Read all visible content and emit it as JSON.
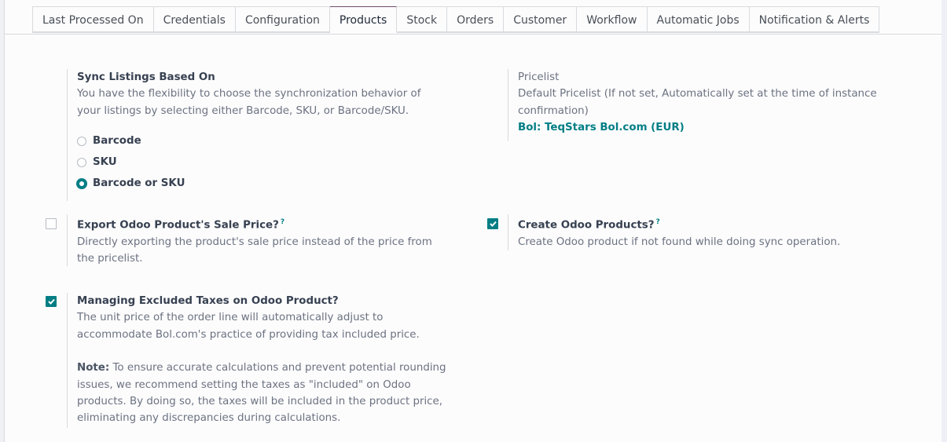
{
  "tabs": [
    {
      "label": "Last Processed On",
      "active": false
    },
    {
      "label": "Credentials",
      "active": false
    },
    {
      "label": "Configuration",
      "active": false
    },
    {
      "label": "Products",
      "active": true
    },
    {
      "label": "Stock",
      "active": false
    },
    {
      "label": "Orders",
      "active": false
    },
    {
      "label": "Customer",
      "active": false
    },
    {
      "label": "Workflow",
      "active": false
    },
    {
      "label": "Automatic Jobs",
      "active": false
    },
    {
      "label": "Notification & Alerts",
      "active": false
    }
  ],
  "sync_listings": {
    "label": "Sync Listings Based On",
    "description": "You have the flexibility to choose the synchronization behavior of your listings by selecting either Barcode, SKU, or Barcode/SKU.",
    "options": [
      {
        "label": "Barcode",
        "checked": false
      },
      {
        "label": "SKU",
        "checked": false
      },
      {
        "label": "Barcode or SKU",
        "checked": true
      }
    ]
  },
  "pricelist": {
    "label": "Pricelist",
    "description": "Default Pricelist (If not set, Automatically set at the time of instance confirmation)",
    "value": "Bol: TeqStars Bol.com (EUR)"
  },
  "export_sale_price": {
    "label": "Export Odoo Product's Sale Price?",
    "help": "?",
    "description": "Directly exporting the product's sale price instead of the price from the pricelist.",
    "checked": false
  },
  "create_products": {
    "label": "Create Odoo Products?",
    "help": "?",
    "description": "Create Odoo product if not found while doing sync operation.",
    "checked": true
  },
  "excluded_taxes": {
    "label": "Managing Excluded Taxes on Odoo Product?",
    "description": "The unit price of the order line will automatically adjust to accommodate Bol.com's practice of providing tax included price.",
    "note_label": "Note:",
    "note_text": " To ensure accurate calculations and prevent potential rounding issues, we recommend setting the taxes as \"included\" on Odoo products. By doing so, the taxes will be included in the product price, eliminating any discrepancies during calculations.",
    "checked": true
  },
  "colors": {
    "accent": "#017e84",
    "active_tab_top": "#714b67"
  }
}
